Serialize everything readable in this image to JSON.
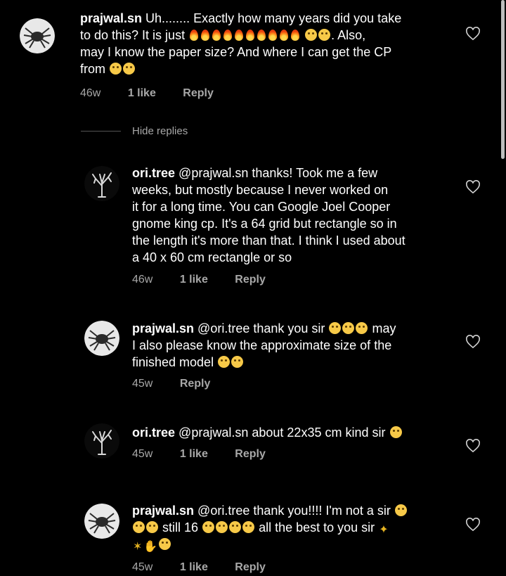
{
  "comments": [
    {
      "user": "prajwal.sn",
      "avatar": "spider-avatar",
      "lines": [
        "Uh........ Exactly how many years did you take",
        "to do this? It is just",
        ". Also,",
        "may I know the paper size? And where I can get the CP",
        "from"
      ],
      "age": "46w",
      "likes": "1 like",
      "reply": "Reply"
    },
    {
      "user": "ori.tree",
      "avatar": "tree-avatar",
      "mention": "@prajwal.sn",
      "lines": [
        "thanks! Took me a few",
        "weeks, but mostly because I never worked on",
        "it for a long time. You can Google Joel Cooper",
        "gnome king cp. It's a 64 grid but rectangle so in",
        "the length it's more than that. I think I used about",
        "a  40 x 60 cm rectangle or so"
      ],
      "age": "46w",
      "likes": "1 like",
      "reply": "Reply"
    },
    {
      "user": "prajwal.sn",
      "avatar": "spider-avatar",
      "mention": "@ori.tree",
      "lines": [
        "thank you sir",
        "may",
        "I also please know the approximate size of the",
        "finished model"
      ],
      "age": "45w",
      "reply": "Reply"
    },
    {
      "user": "ori.tree",
      "avatar": "tree-avatar",
      "mention": "@prajwal.sn",
      "lines": [
        "about 22x35 cm kind sir"
      ],
      "age": "45w",
      "likes": "1 like",
      "reply": "Reply"
    },
    {
      "user": "prajwal.sn",
      "avatar": "spider-avatar",
      "mention": "@ori.tree",
      "lines": [
        "thank you!!!! I'm not a sir",
        "still 16",
        "all the best to you sir"
      ],
      "age": "45w",
      "likes": "1 like",
      "reply": "Reply"
    }
  ],
  "hide_replies": "Hide replies",
  "icons": {
    "heart": "heart-outline-icon",
    "fire": "fire-emoji",
    "grin": "grinning-face-emoji",
    "party": "party-popper-emoji",
    "thumbs": "thumbs-up-emoji"
  }
}
